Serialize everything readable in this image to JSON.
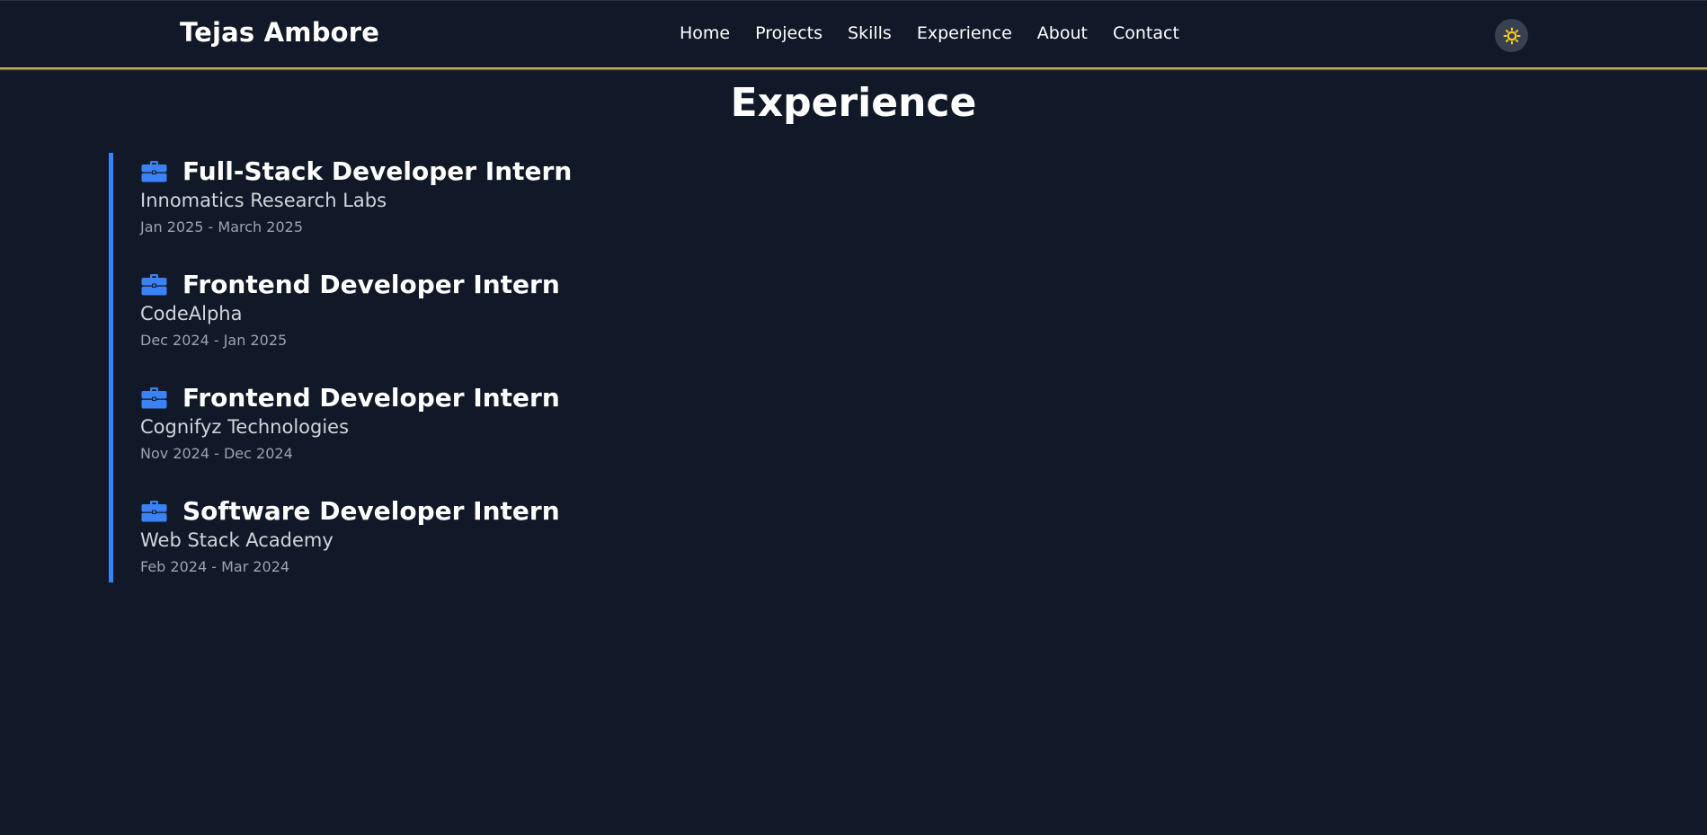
{
  "nav": {
    "brand": "Tejas Ambore",
    "links": [
      {
        "label": "Home"
      },
      {
        "label": "Projects"
      },
      {
        "label": "Skills"
      },
      {
        "label": "Experience"
      },
      {
        "label": "About"
      },
      {
        "label": "Contact"
      }
    ],
    "theme_toggle_icon": "sun-icon"
  },
  "section": {
    "title": "Experience"
  },
  "experience": [
    {
      "role": "Full-Stack Developer Intern",
      "company": "Innomatics Research Labs",
      "dates": "Jan 2025 - March 2025",
      "icon": "briefcase-icon"
    },
    {
      "role": "Frontend Developer Intern",
      "company": "CodeAlpha",
      "dates": "Dec 2024 - Jan 2025",
      "icon": "briefcase-icon"
    },
    {
      "role": "Frontend Developer Intern",
      "company": "Cognifyz Technologies",
      "dates": "Nov 2024 - Dec 2024",
      "icon": "briefcase-icon"
    },
    {
      "role": "Software Developer Intern",
      "company": "Web Stack Academy",
      "dates": "Feb 2024 - Mar 2024",
      "icon": "briefcase-icon"
    }
  ],
  "colors": {
    "background": "#111827",
    "accent": "#3b82f6",
    "sun": "#facc15",
    "navbar_glow": "#c8ae5a"
  }
}
